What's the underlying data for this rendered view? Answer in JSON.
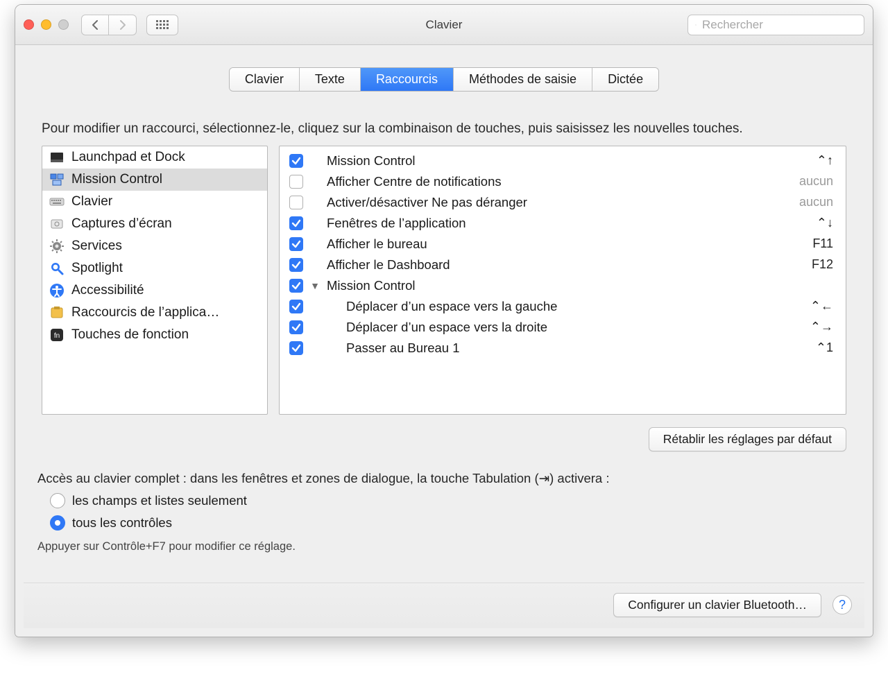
{
  "window": {
    "title": "Clavier",
    "search_placeholder": "Rechercher"
  },
  "tabs": [
    {
      "label": "Clavier",
      "active": false
    },
    {
      "label": "Texte",
      "active": false
    },
    {
      "label": "Raccourcis",
      "active": true
    },
    {
      "label": "Méthodes de saisie",
      "active": false
    },
    {
      "label": "Dictée",
      "active": false
    }
  ],
  "instructions": "Pour modifier un raccourci, sélectionnez-le, cliquez sur la combinaison de touches, puis saisissez les nouvelles touches.",
  "categories": [
    {
      "label": "Launchpad et Dock",
      "icon": "launchpad",
      "selected": false
    },
    {
      "label": "Mission Control",
      "icon": "mission",
      "selected": true
    },
    {
      "label": "Clavier",
      "icon": "keyboard",
      "selected": false
    },
    {
      "label": "Captures d’écran",
      "icon": "screenshot",
      "selected": false
    },
    {
      "label": "Services",
      "icon": "gear",
      "selected": false
    },
    {
      "label": "Spotlight",
      "icon": "spotlight",
      "selected": false
    },
    {
      "label": "Accessibilité",
      "icon": "accessibility",
      "selected": false
    },
    {
      "label": "Raccourcis de l’applica…",
      "icon": "appshortcuts",
      "selected": false
    },
    {
      "label": "Touches de fonction",
      "icon": "fn",
      "selected": false
    }
  ],
  "shortcuts": [
    {
      "checked": true,
      "label": "Mission Control",
      "key": "⌃↑",
      "group": false,
      "indent": false
    },
    {
      "checked": false,
      "label": "Afficher Centre de notifications",
      "key": "aucun",
      "group": false,
      "indent": false,
      "none": true
    },
    {
      "checked": false,
      "label": "Activer/désactiver Ne pas déranger",
      "key": "aucun",
      "group": false,
      "indent": false,
      "none": true
    },
    {
      "checked": true,
      "label": "Fenêtres de l’application",
      "key": "⌃↓",
      "group": false,
      "indent": false
    },
    {
      "checked": true,
      "label": "Afficher le bureau",
      "key": "F11",
      "group": false,
      "indent": false
    },
    {
      "checked": true,
      "label": "Afficher le Dashboard",
      "key": "F12",
      "group": false,
      "indent": false
    },
    {
      "checked": true,
      "label": "Mission Control",
      "key": "",
      "group": true,
      "indent": false
    },
    {
      "checked": true,
      "label": "Déplacer d’un espace vers la gauche",
      "key": "⌃←",
      "group": false,
      "indent": true
    },
    {
      "checked": true,
      "label": "Déplacer d’un espace vers la droite",
      "key": "⌃→",
      "group": false,
      "indent": true
    },
    {
      "checked": true,
      "label": "Passer au Bureau 1",
      "key": "⌃1",
      "group": false,
      "indent": true
    }
  ],
  "restore_label": "Rétablir les réglages par défaut",
  "full_access": {
    "text": "Accès au clavier complet : dans les fenêtres et zones de dialogue, la touche Tabulation (⇥) activera :",
    "options": [
      {
        "label": "les champs et listes seulement",
        "selected": false
      },
      {
        "label": "tous les contrôles",
        "selected": true
      }
    ],
    "hint": "Appuyer sur Contrôle+F7 pour modifier ce réglage."
  },
  "footer": {
    "bluetooth": "Configurer un clavier Bluetooth…"
  }
}
